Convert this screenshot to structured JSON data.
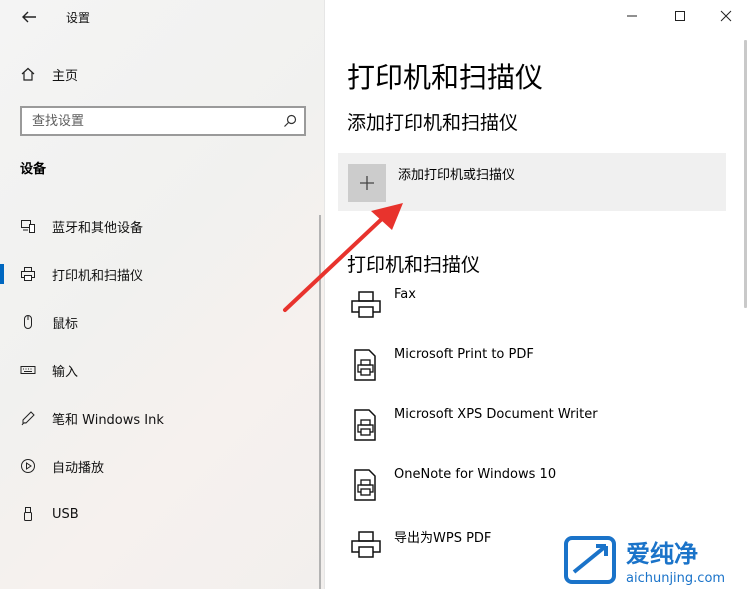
{
  "window": {
    "title": "设置",
    "controls": {
      "minimize": "minimize-icon",
      "maximize": "maximize-icon",
      "close": "close-icon"
    }
  },
  "sidebar": {
    "home_label": "主页",
    "search_placeholder": "查找设置",
    "section_title": "设备",
    "items": [
      {
        "label": "蓝牙和其他设备",
        "icon": "bluetooth-devices-icon"
      },
      {
        "label": "打印机和扫描仪",
        "icon": "printer-icon",
        "active": true
      },
      {
        "label": "鼠标",
        "icon": "mouse-icon"
      },
      {
        "label": "输入",
        "icon": "keyboard-icon"
      },
      {
        "label": "笔和 Windows Ink",
        "icon": "pen-icon"
      },
      {
        "label": "自动播放",
        "icon": "autoplay-icon"
      },
      {
        "label": "USB",
        "icon": "usb-icon"
      }
    ]
  },
  "main": {
    "page_title": "打印机和扫描仪",
    "add_section_title": "添加打印机和扫描仪",
    "add_button_label": "添加打印机或扫描仪",
    "list_title": "打印机和扫描仪",
    "printers": [
      {
        "name": "Fax"
      },
      {
        "name": "Microsoft Print to PDF"
      },
      {
        "name": "Microsoft XPS Document Writer"
      },
      {
        "name": "OneNote for Windows 10"
      },
      {
        "name": "导出为WPS PDF"
      }
    ]
  },
  "watermark": {
    "brand": "爱纯净",
    "url": "aichunjing.com"
  },
  "colors": {
    "accent": "#0067c0",
    "arrow": "#e8332d",
    "logo_blue": "#1a73c9"
  }
}
